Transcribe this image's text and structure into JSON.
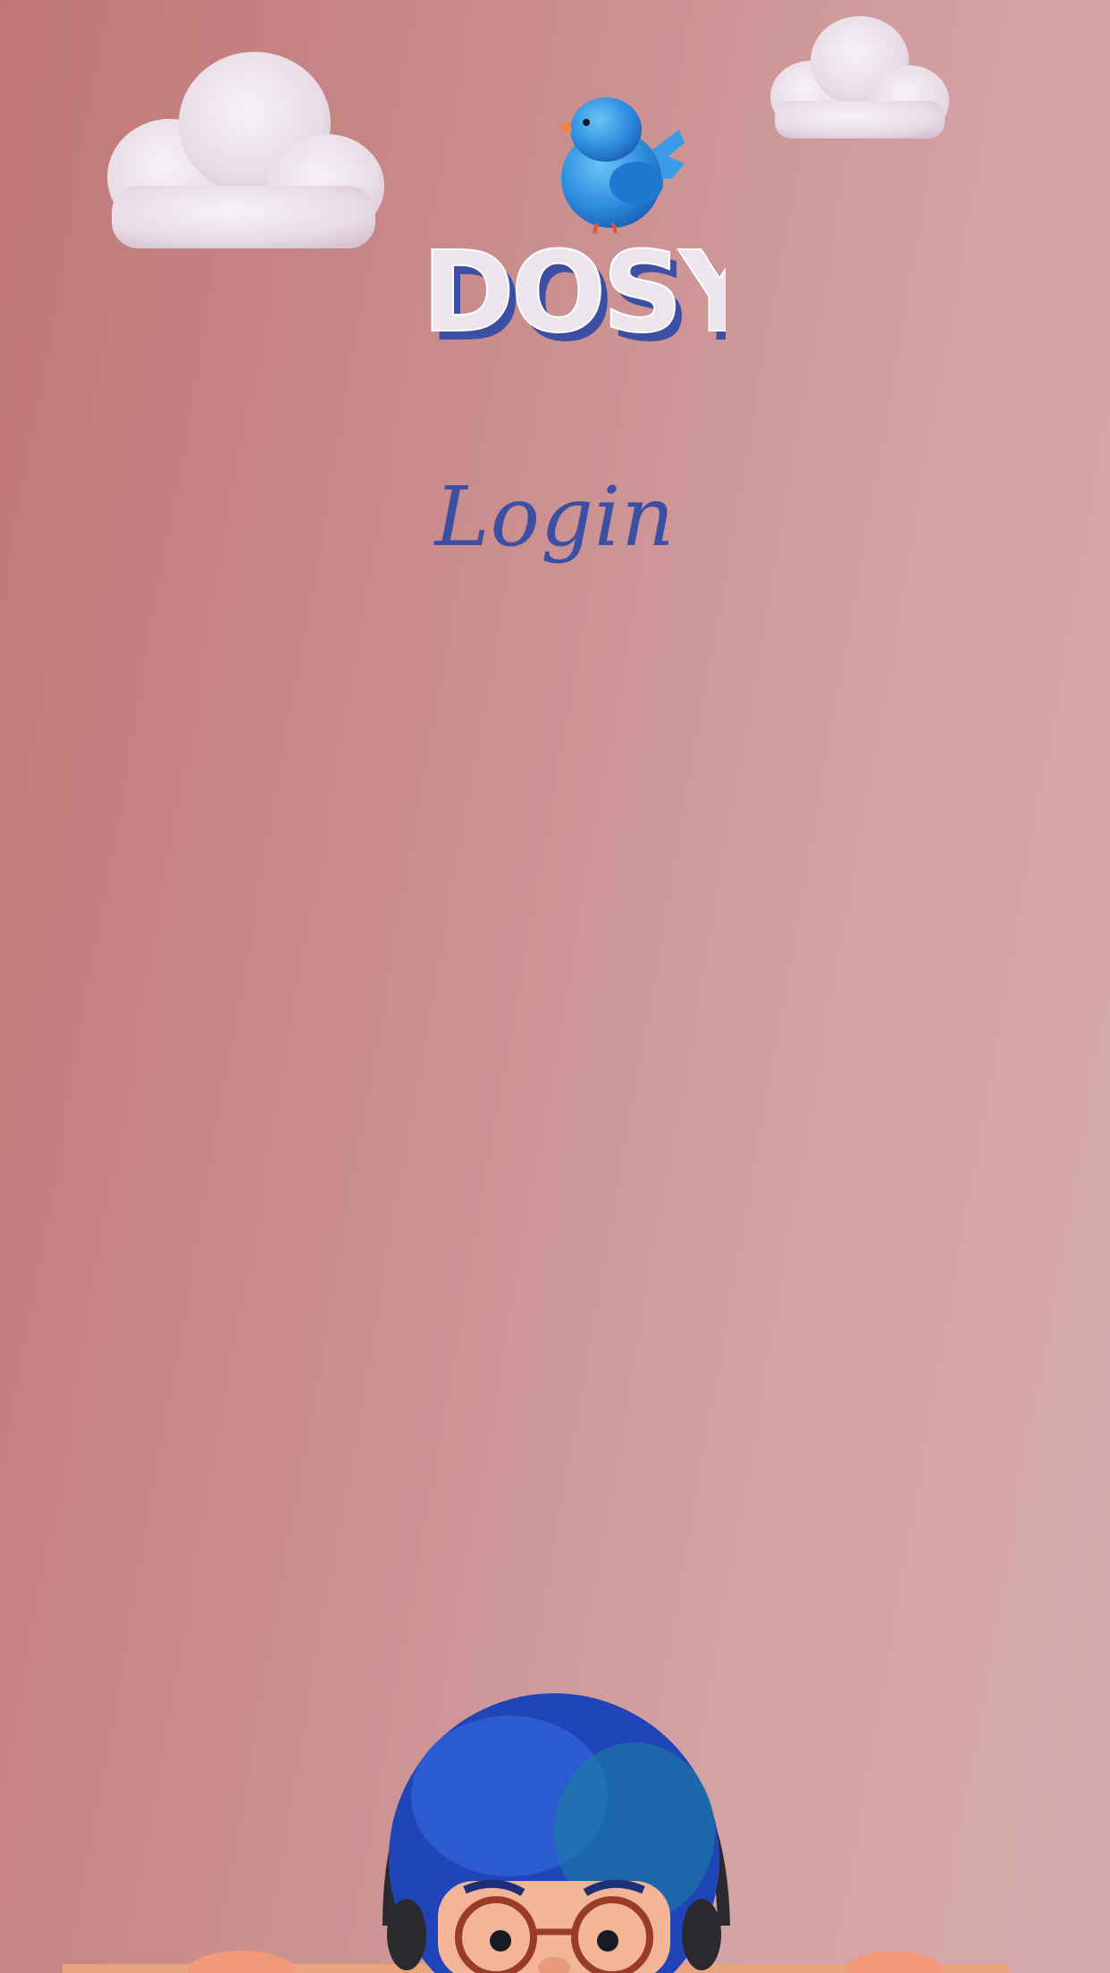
{
  "app": {
    "logo_text": "DOSY",
    "login_label": "Login"
  },
  "colors": {
    "accent": "#3c4fa3",
    "background_left": "#c07777",
    "background_right": "#d6abad",
    "cloud": "#efe6ee"
  },
  "icons": {
    "bird": "blue-bird-icon",
    "cloud": "cloud-icon",
    "character": "blue-haired-character-illustration"
  }
}
